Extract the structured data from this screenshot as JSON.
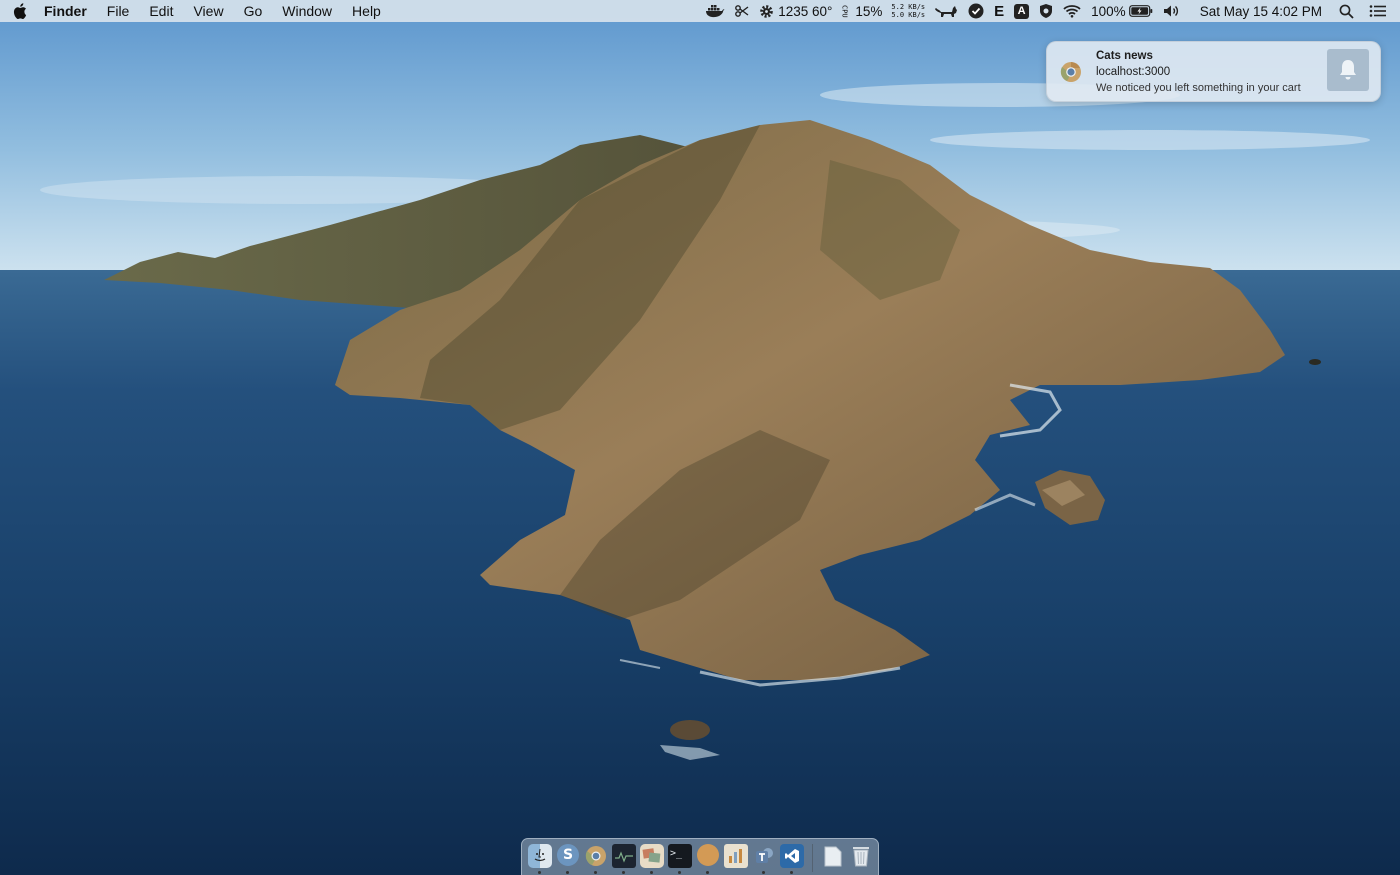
{
  "menubar": {
    "app_name": "Finder",
    "menus": [
      "File",
      "Edit",
      "View",
      "Go",
      "Window",
      "Help"
    ],
    "status": {
      "cpu_text": "1235 60°",
      "cpu_vertical": "CPU",
      "cpu_percent": "15%",
      "net_up": "5.2 KB/s",
      "net_down": "5.0 KB/s",
      "e_letter": "E",
      "a_letter": "A",
      "battery_percent": "100%",
      "datetime": "Sat May 15  4:02 PM"
    },
    "icons": [
      "apple-icon",
      "docker-icon",
      "scissors-icon",
      "gear-icon",
      "cat-icon",
      "check-icon",
      "shield-icon",
      "wifi-icon",
      "battery-icon",
      "volume-icon",
      "search-icon",
      "list-icon"
    ]
  },
  "notification": {
    "title": "Cats news",
    "subtitle": "localhost:3000",
    "body": "We noticed you left something in your cart",
    "icon": "chrome-icon"
  },
  "dock": {
    "apps": [
      {
        "name": "finder",
        "icon": "finder-icon",
        "running": true
      },
      {
        "name": "skype",
        "icon": "skype-icon",
        "running": true
      },
      {
        "name": "chrome",
        "icon": "chrome-icon",
        "running": true
      },
      {
        "name": "activity",
        "icon": "activity-monitor-icon",
        "running": true
      },
      {
        "name": "photos",
        "icon": "photos-icon",
        "running": true
      },
      {
        "name": "terminal",
        "icon": "terminal-icon",
        "running": true
      },
      {
        "name": "compass",
        "icon": "compass-icon",
        "running": true
      },
      {
        "name": "charts",
        "icon": "charts-icon",
        "running": false
      },
      {
        "name": "teams",
        "icon": "teams-icon",
        "running": true
      },
      {
        "name": "vscode",
        "icon": "vscode-icon",
        "running": true
      }
    ],
    "right": [
      {
        "name": "documents",
        "icon": "document-icon"
      },
      {
        "name": "trash",
        "icon": "trash-icon"
      }
    ]
  },
  "colors": {
    "sky_top": "#5d97cf",
    "sky_horizon": "#c9e0ee",
    "ocean_deep": "#0f2c4f",
    "ocean_mid": "#1e4a78",
    "rock": "#8a7150"
  }
}
